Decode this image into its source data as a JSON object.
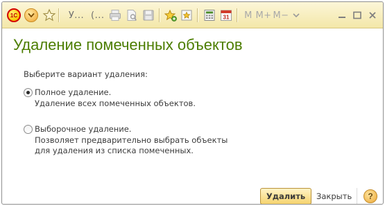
{
  "toolbar": {
    "logo_text": "1С",
    "nav_menu_icon": "chevron-down-icon",
    "favorite_icon": "star-icon",
    "truncated_a": "У...",
    "truncated_b": "(...",
    "memory_m": "M",
    "memory_mplus": "M+",
    "memory_mminus": "M−",
    "window_controls": [
      "chevron-down",
      "minimize",
      "maximize",
      "close"
    ]
  },
  "form": {
    "title": "Удаление помеченных объектов",
    "prompt": "Выберите вариант удаления:",
    "options": [
      {
        "label": "Полное удаление.",
        "description": [
          "Удаление всех помеченных объектов."
        ],
        "checked": true
      },
      {
        "label": "Выборочное удаление.",
        "description": [
          "Позволяет предварительно выбрать объекты",
          "для удаления из списка помеченных."
        ],
        "checked": false
      }
    ]
  },
  "footer": {
    "delete_label": "Удалить",
    "close_label": "Закрыть",
    "help_label": "?"
  },
  "colors": {
    "title": "#4c7d00",
    "toolbar_top": "#fcf6d8",
    "toolbar_bottom": "#f3e7a9",
    "primary_button": "#f5d36e"
  }
}
